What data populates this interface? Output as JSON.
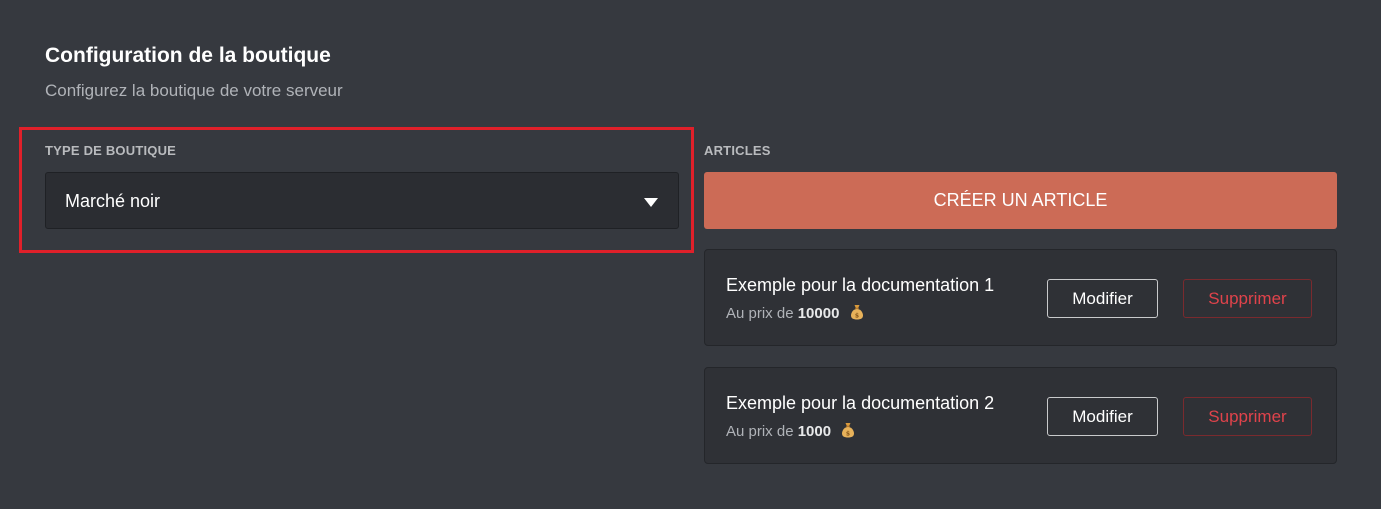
{
  "header": {
    "title": "Configuration de la boutique",
    "subtitle": "Configurez la boutique de votre serveur"
  },
  "shop_type": {
    "label": "TYPE DE BOUTIQUE",
    "selected": "Marché noir",
    "highlight_color": "#e0202a"
  },
  "articles": {
    "label": "ARTICLES",
    "create_label": "CRÉER UN ARTICLE",
    "create_color": "#cc6b56",
    "items": [
      {
        "name": "Exemple pour la documentation 1",
        "price_prefix": "Au prix de",
        "price": "10000",
        "icon": "money-bag-icon",
        "edit_label": "Modifier",
        "delete_label": "Supprimer"
      },
      {
        "name": "Exemple pour la documentation 2",
        "price_prefix": "Au prix de",
        "price": "1000",
        "icon": "money-bag-icon",
        "edit_label": "Modifier",
        "delete_label": "Supprimer"
      }
    ]
  },
  "colors": {
    "background": "#36393f",
    "card": "#2f3136",
    "select": "#2b2d32",
    "danger": "#e0434b"
  }
}
